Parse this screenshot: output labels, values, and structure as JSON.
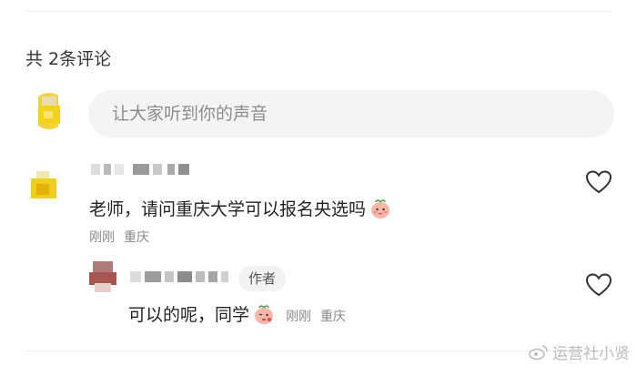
{
  "comments_header": {
    "count_label": "共 2条评论"
  },
  "input": {
    "placeholder": "让大家听到你的声音"
  },
  "comments": [
    {
      "text": "老师，请问重庆大学可以报名央选吗",
      "time": "刚刚",
      "location": "重庆",
      "emoji": "peach-face-emoji",
      "reply": {
        "badge": "作者",
        "text": "可以的呢，同学",
        "time": "刚刚",
        "location": "重庆",
        "emoji": "peach-blush-emoji"
      }
    }
  ],
  "watermark": {
    "text": "运营社小贤",
    "icon": "weibo-icon"
  },
  "colors": {
    "input_bg": "#f4f4f4",
    "meta_text": "#888888",
    "badge_bg": "#f2f2f2"
  }
}
